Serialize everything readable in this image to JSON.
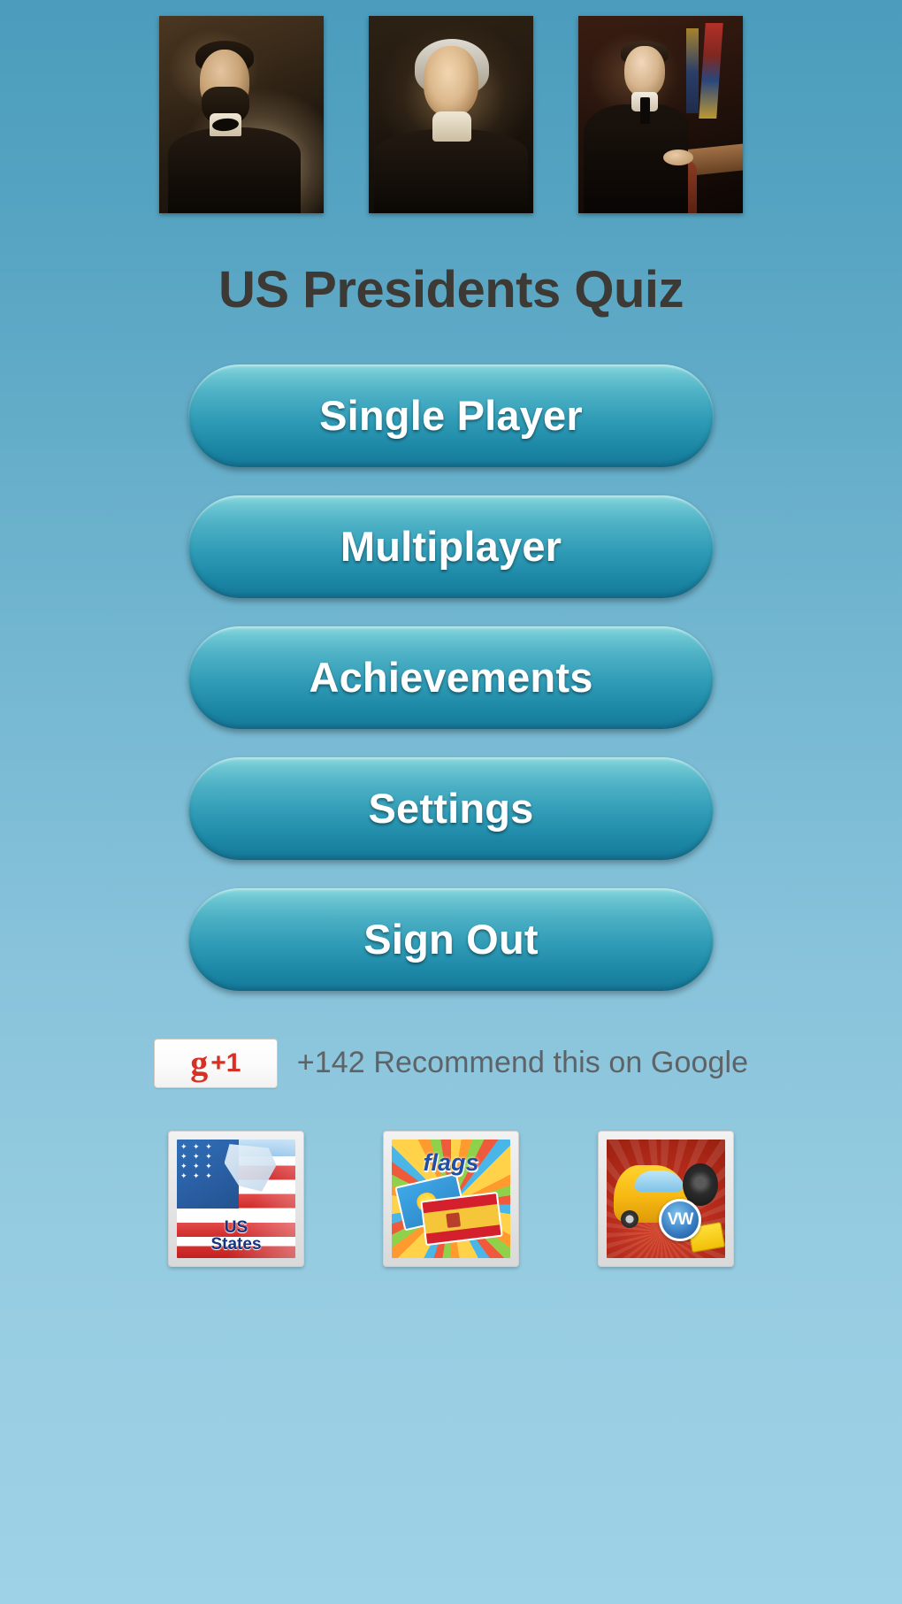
{
  "app": {
    "title": "US Presidents Quiz",
    "background_top_color": "#4b9cbd",
    "background_bottom_color": "#9ed2e6",
    "title_color": "#3d3935"
  },
  "header_portraits": [
    {
      "name": "abraham-lincoln-portrait",
      "alt": "Abraham Lincoln portrait"
    },
    {
      "name": "thomas-jefferson-portrait",
      "alt": "Thomas Jefferson portrait"
    },
    {
      "name": "franklin-d-roosevelt-portrait",
      "alt": "Franklin D. Roosevelt portrait"
    }
  ],
  "menu": {
    "button_fill_top": "#8ddbe0",
    "button_fill_bottom": "#16789a",
    "button_text_color": "#ffffff",
    "buttons": [
      {
        "id": "single-player",
        "label": "Single Player"
      },
      {
        "id": "multiplayer",
        "label": "Multiplayer"
      },
      {
        "id": "achievements",
        "label": "Achievements"
      },
      {
        "id": "settings",
        "label": "Settings"
      },
      {
        "id": "sign-out",
        "label": "Sign Out"
      }
    ]
  },
  "google_plus": {
    "badge_g": "g",
    "badge_plus_one": "+1",
    "badge_color": "#d93025",
    "recommend_text": "+142 Recommend this on Google",
    "count": "+142",
    "text_color": "#5e6367"
  },
  "promo_apps": [
    {
      "id": "us-states",
      "label_line1": "US",
      "label_line2": "States",
      "icon_name": "us-states-app-icon"
    },
    {
      "id": "flags",
      "label": "flags",
      "icon_name": "flags-app-icon"
    },
    {
      "id": "car-logos",
      "badge_text": "VW",
      "icon_name": "car-logos-app-icon"
    }
  ]
}
